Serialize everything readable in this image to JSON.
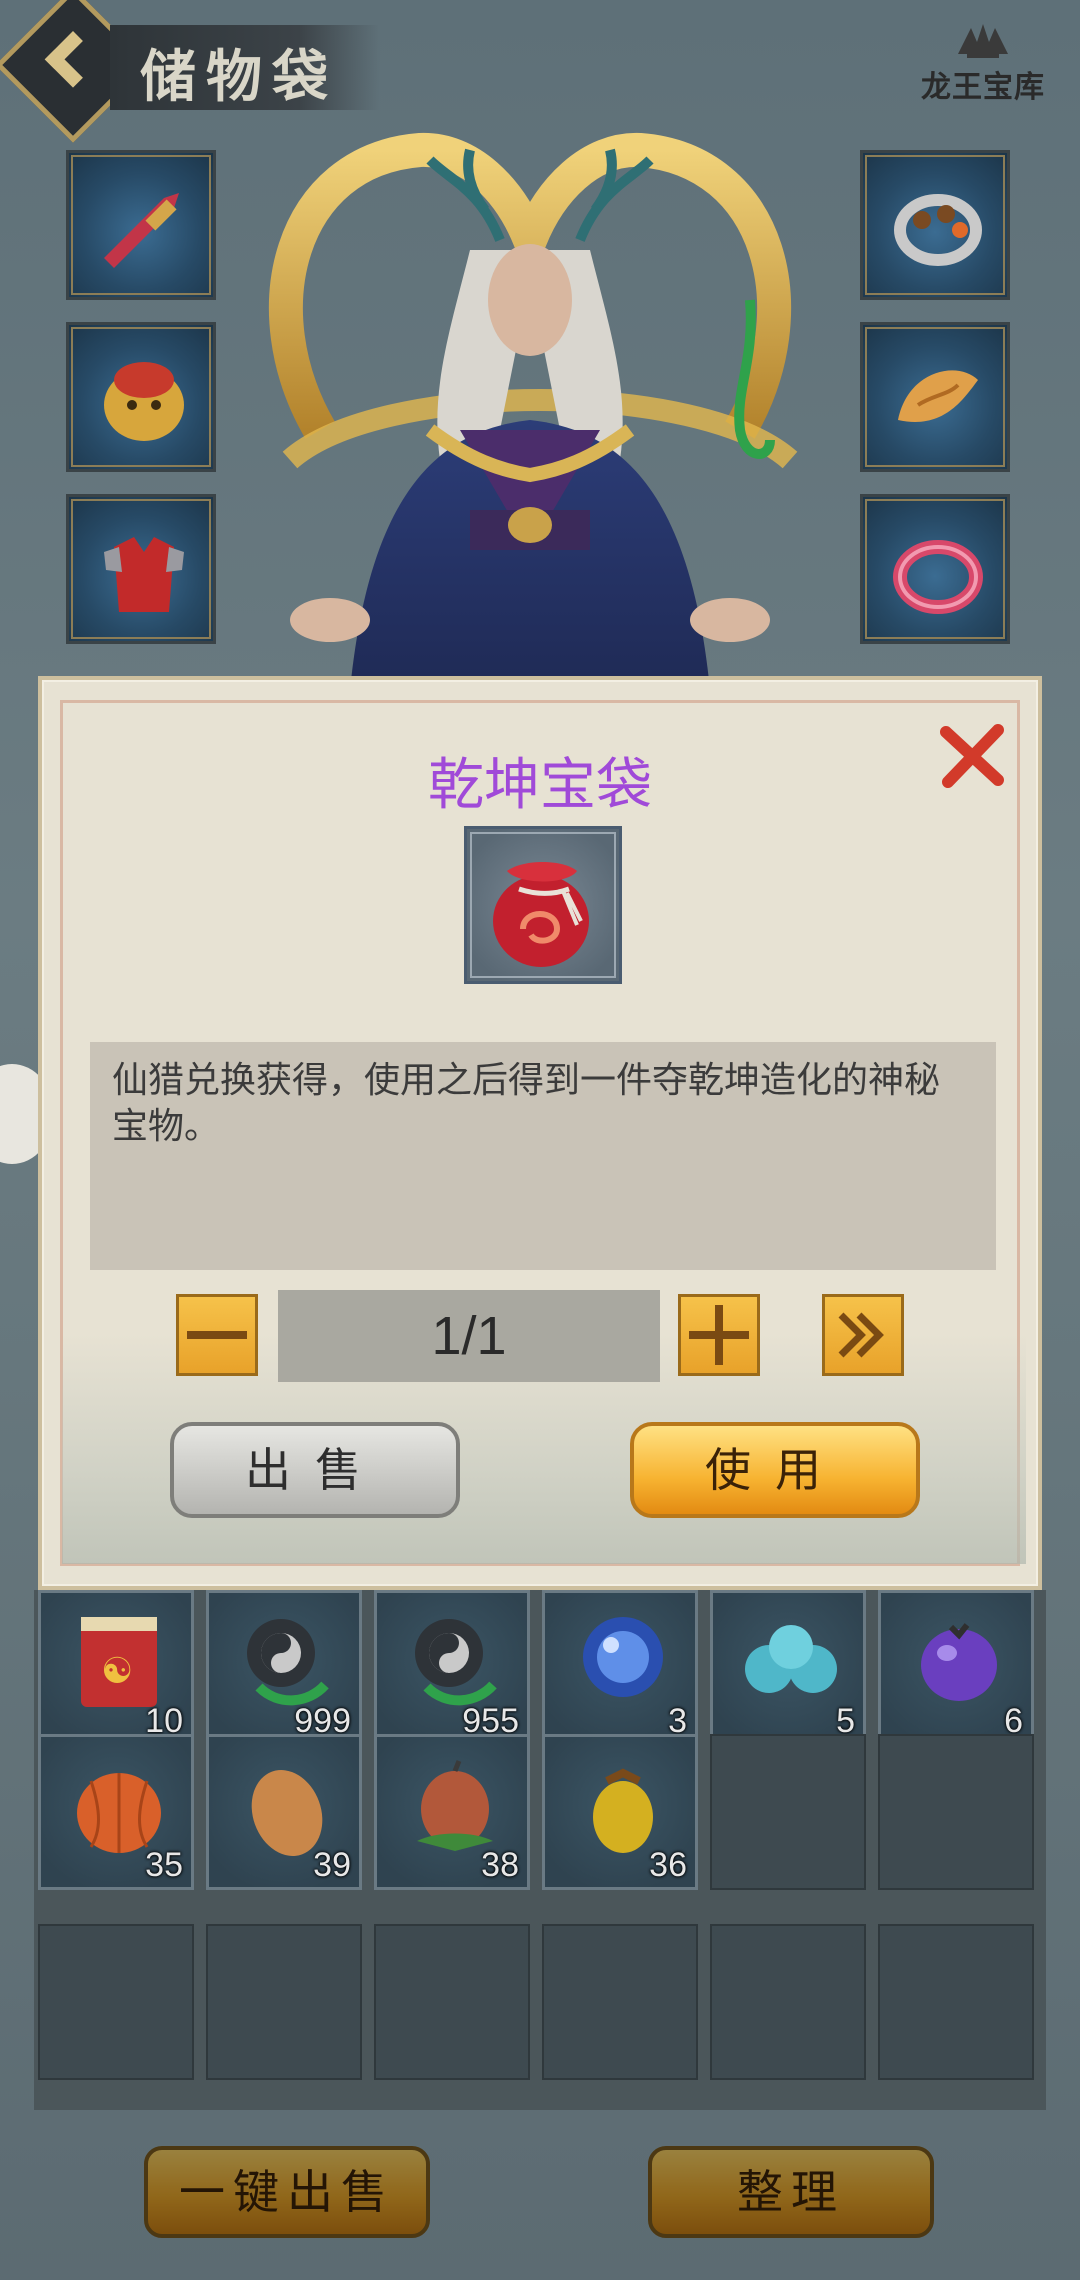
{
  "header": {
    "title": "储物袋",
    "logo_text": "龙王宝库"
  },
  "equipment": {
    "left": [
      "sword-icon",
      "lion-helmet-icon",
      "red-armor-icon"
    ],
    "right": [
      "ring-bracelet-icon",
      "jade-pendant-icon",
      "pink-bangle-icon"
    ]
  },
  "dialog": {
    "title": "乾坤宝袋",
    "item_icon": "red-treasure-bag-icon",
    "description": "仙猎兑换获得，使用之后得到一件夺乾坤造化的神秘宝物。",
    "quantity": "1/1",
    "sell_label": "出售",
    "use_label": "使用"
  },
  "inventory": {
    "row1": [
      {
        "icon": "red-scroll-icon",
        "qty": "10"
      },
      {
        "icon": "yin-yang-bead-icon",
        "qty": "999"
      },
      {
        "icon": "yin-yang-bead-icon",
        "qty": "955"
      },
      {
        "icon": "blue-orb-icon",
        "qty": "3"
      },
      {
        "icon": "cyan-fruit-icon",
        "qty": "5"
      },
      {
        "icon": "purple-fruit-icon",
        "qty": "6"
      }
    ],
    "row2": [
      {
        "icon": "orange-fruit-icon",
        "qty": "35"
      },
      {
        "icon": "potato-fruit-icon",
        "qty": "39"
      },
      {
        "icon": "peach-fruit-icon",
        "qty": "38"
      },
      {
        "icon": "yellow-fruit-icon",
        "qty": "36"
      }
    ]
  },
  "footer": {
    "sell_all_label": "一键出售",
    "sort_label": "整理"
  },
  "colors": {
    "title_purple": "#a04ad8",
    "gold": "#f0b13a",
    "panel": "#e7e2d3"
  }
}
